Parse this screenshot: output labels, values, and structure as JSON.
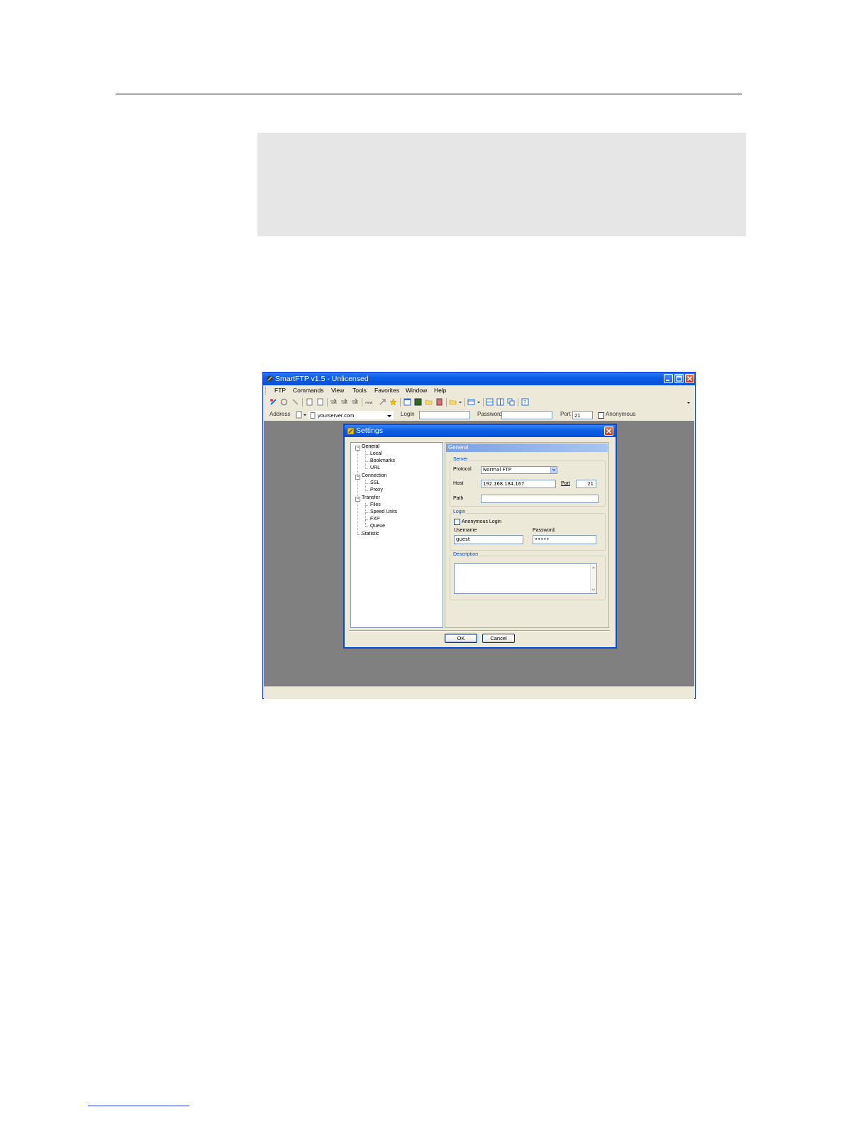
{
  "window": {
    "title": "SmartFTP v1.5 - Unlicensed"
  },
  "menu": [
    "FTP",
    "Commands",
    "View",
    "Tools",
    "Favorites",
    "Window",
    "Help"
  ],
  "address_bar": {
    "address_label": "Address",
    "address_value": "yourserver.com",
    "login_label": "Login",
    "login_value": "",
    "password_label": "Password",
    "password_value": "",
    "port_label": "Port",
    "port_value": "21",
    "anonymous_label": "Anonymous"
  },
  "settings_dialog": {
    "title": "Settings",
    "tree": {
      "general": "General",
      "local": "Local",
      "bookmarks": "Bookmarks",
      "url": "URL",
      "connection": "Connection",
      "ssl": "SSL",
      "proxy": "Proxy",
      "transfer": "Transfer",
      "files": "Files",
      "speed_units": "Speed Units",
      "fxp": "FXP",
      "queue": "Queue",
      "statistic": "Statistic"
    },
    "panel_title": "General",
    "server_group": "Server",
    "protocol_label": "Protocol",
    "protocol_value": "Normal FTP",
    "host_label": "Host",
    "host_value": "192.168.184.167",
    "port_label": "Port",
    "port_value": "21",
    "path_label": "Path",
    "path_value": "",
    "login_group": "Login",
    "anonymous_login_label": "Anonymous Login",
    "username_label": "Username",
    "username_value": "guest",
    "password_label": "Password:",
    "password_value": "•••••",
    "description_group": "Description",
    "ok_label": "OK",
    "cancel_label": "Cancel"
  },
  "colors": {
    "titlebar": "#0a5ee8",
    "desktop_gray": "#808080",
    "panel_header": "#7ba2e7",
    "close_button": "#c4371b"
  }
}
